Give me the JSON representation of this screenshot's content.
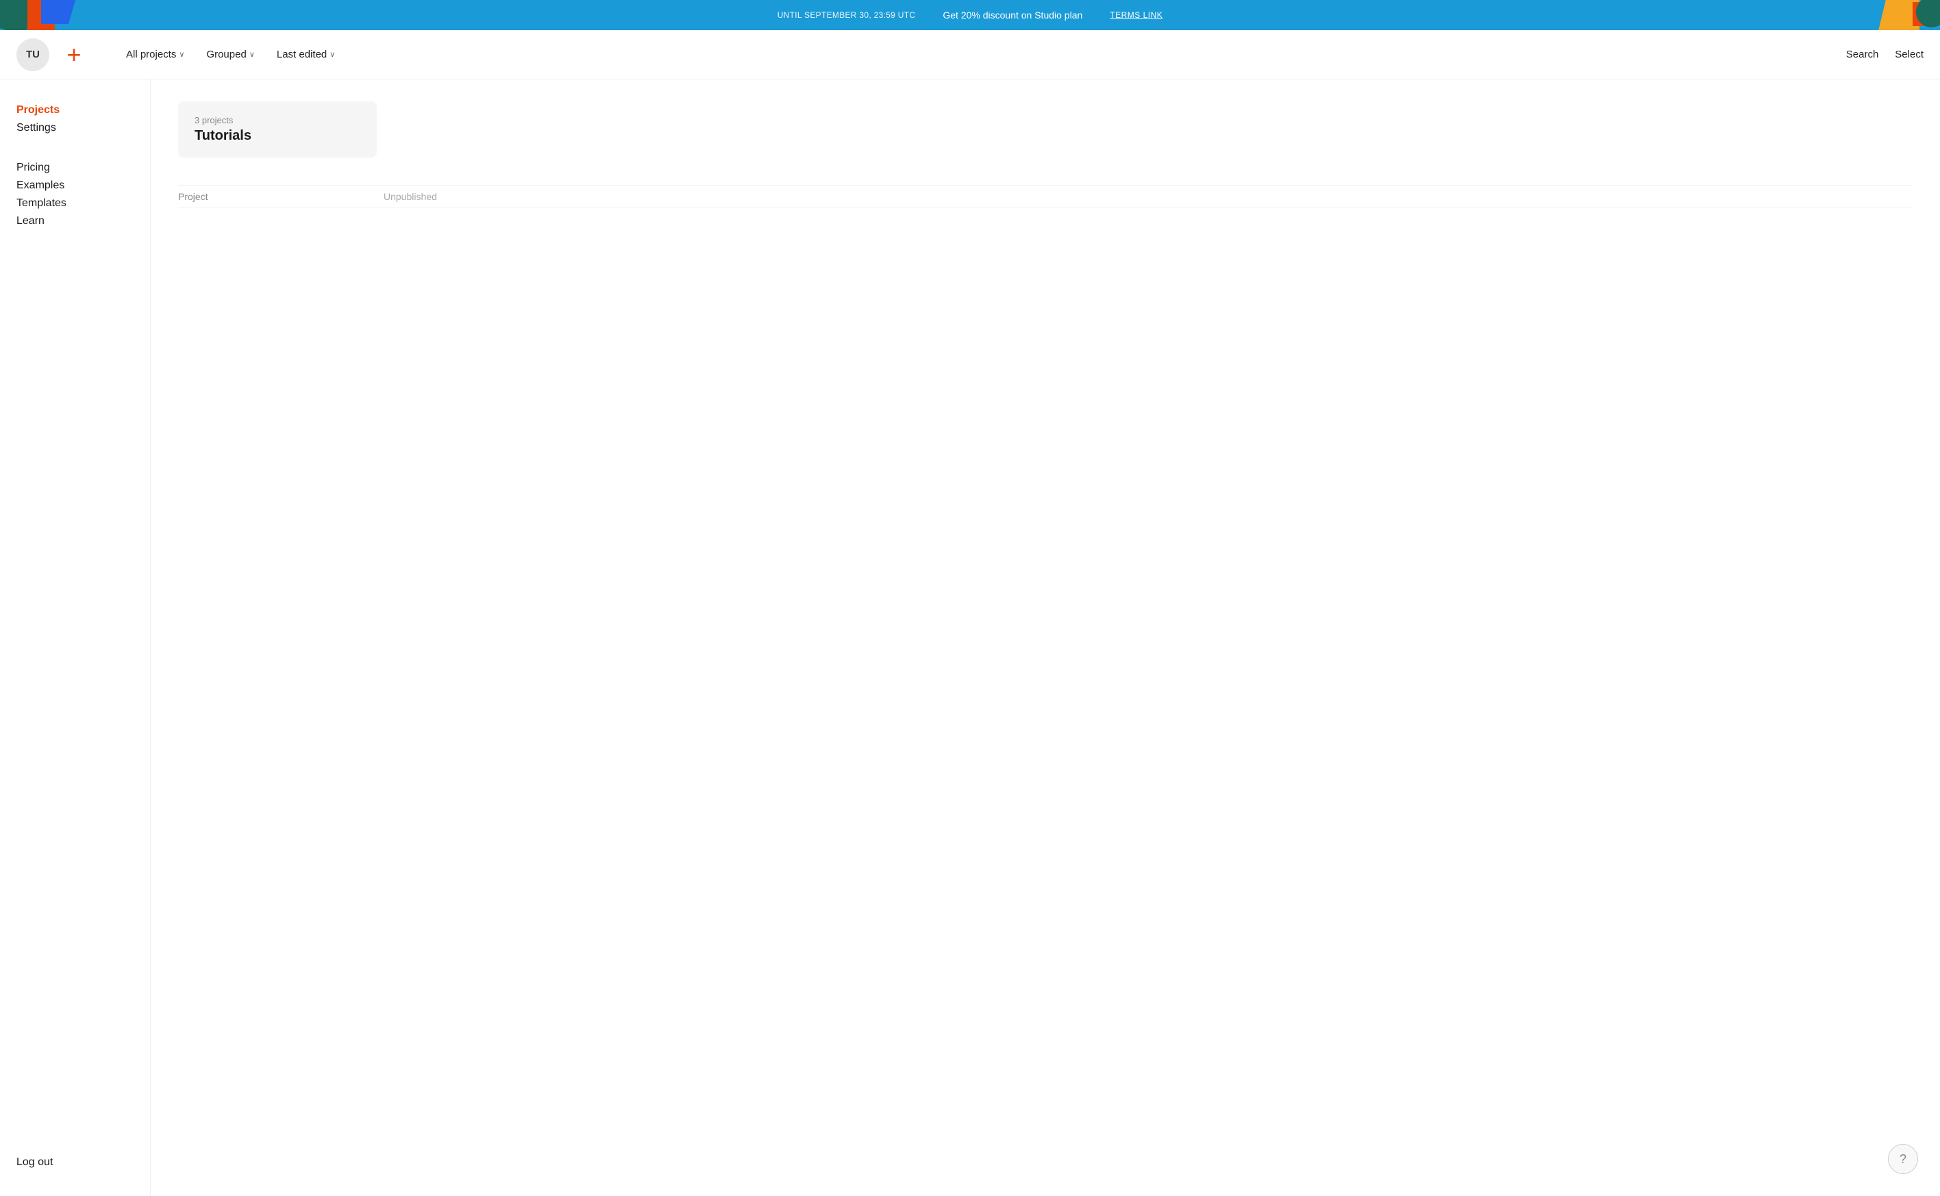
{
  "promo": {
    "until_text": "UNTIL SEPTEMBER 30, 23:59 UTC",
    "main_text": "Get 20% discount on Studio plan",
    "link_text": "TERMS LINK"
  },
  "nav": {
    "avatar_initials": "TU",
    "filters": [
      {
        "label": "All projects",
        "has_chevron": true
      },
      {
        "label": "Grouped",
        "has_chevron": true
      },
      {
        "label": "Last edited",
        "has_chevron": true
      }
    ],
    "right_actions": [
      {
        "label": "Search"
      },
      {
        "label": "Select"
      }
    ]
  },
  "sidebar": {
    "items": [
      {
        "label": "Projects",
        "active": true
      },
      {
        "label": "Settings",
        "active": false
      }
    ],
    "extra_items": [
      {
        "label": "Pricing"
      },
      {
        "label": "Examples"
      },
      {
        "label": "Templates"
      },
      {
        "label": "Learn"
      }
    ],
    "logout_label": "Log out"
  },
  "main": {
    "group_card": {
      "count_label": "3 projects",
      "name": "Tutorials"
    },
    "project_list": {
      "columns": [
        {
          "label": "Project"
        },
        {
          "label": "Unpublished"
        }
      ]
    }
  },
  "help": {
    "icon": "?"
  }
}
